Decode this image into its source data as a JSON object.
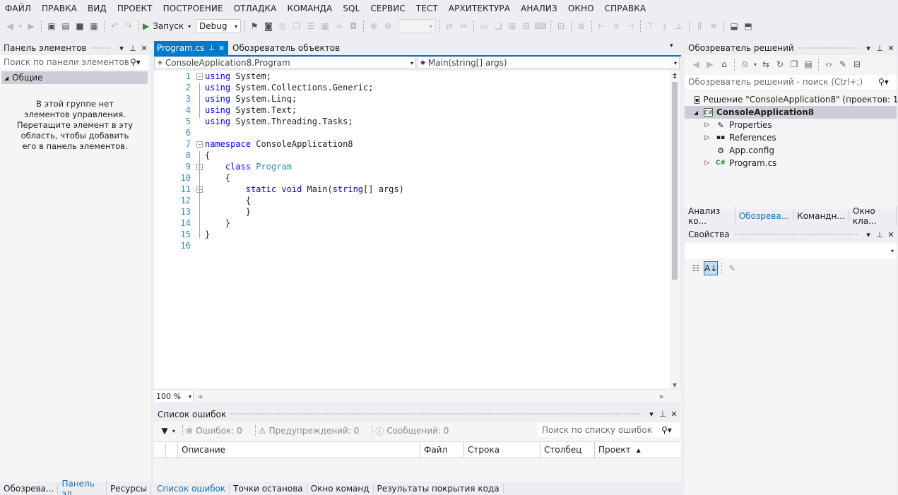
{
  "menu": [
    "ФАЙЛ",
    "ПРАВКА",
    "ВИД",
    "ПРОЕКТ",
    "ПОСТРОЕНИЕ",
    "ОТЛАДКА",
    "КОМАНДА",
    "SQL",
    "СЕРВИС",
    "ТЕСТ",
    "АРХИТЕКТУРА",
    "АНАЛИЗ",
    "ОКНО",
    "СПРАВКА"
  ],
  "toolbar": {
    "run_label": "Запуск",
    "config": "Debug"
  },
  "toolbox": {
    "title": "Панель элементов",
    "search_placeholder": "Поиск по панели элементов",
    "group": "Общие",
    "empty_message": "В этой группе нет элементов управления. Перетащите элемент в эту область, чтобы добавить его в панель элементов."
  },
  "left_tabs": [
    "Обозрева...",
    "Панель эл...",
    "Ресурсы"
  ],
  "editor": {
    "tabs": [
      "Program.cs",
      "Обозреватель объектов"
    ],
    "nav_left": "ConsoleApplication8.Program",
    "nav_right": "Main(string[] args)",
    "zoom": "100 %",
    "lines": [
      {
        "n": "1",
        "t": "using System;"
      },
      {
        "n": "2",
        "t": "using System.Collections.Generic;"
      },
      {
        "n": "3",
        "t": "using System.Linq;"
      },
      {
        "n": "4",
        "t": "using System.Text;"
      },
      {
        "n": "5",
        "t": "using System.Threading.Tasks;"
      },
      {
        "n": "6",
        "t": ""
      },
      {
        "n": "7",
        "t": "namespace ConsoleApplication8"
      },
      {
        "n": "8",
        "t": "{"
      },
      {
        "n": "9",
        "t": "    class Program"
      },
      {
        "n": "10",
        "t": "    {"
      },
      {
        "n": "11",
        "t": "        static void Main(string[] args)"
      },
      {
        "n": "12",
        "t": "        {"
      },
      {
        "n": "13",
        "t": "        }"
      },
      {
        "n": "14",
        "t": "    }"
      },
      {
        "n": "15",
        "t": "}"
      },
      {
        "n": "16",
        "t": ""
      }
    ]
  },
  "errors": {
    "title": "Список ошибок",
    "errors_btn": "Ошибок: 0",
    "warnings_btn": "Предупреждений: 0",
    "messages_btn": "Сообщений: 0",
    "search_placeholder": "Поиск по списку ошибок",
    "columns": [
      "Описание",
      "Файл",
      "Строка",
      "Столбец",
      "Проект"
    ]
  },
  "bottom_tabs": [
    "Список ошибок",
    "Точки останова",
    "Окно команд",
    "Результаты покрытия кода"
  ],
  "solution": {
    "title": "Обозреватель решений",
    "search_placeholder": "Обозреватель решений - поиск (Ctrl+;)",
    "solution_label": "Решение \"ConsoleApplication8\"  (проектов: 1)",
    "project": "ConsoleApplication8",
    "items": [
      "Properties",
      "References",
      "App.config",
      "Program.cs"
    ],
    "tabs": [
      "Анализ ко...",
      "Обозрева...",
      "Командн...",
      "Окно кла..."
    ]
  },
  "properties": {
    "title": "Свойства"
  },
  "colors": {
    "accent": "#007acc",
    "tab_active": "#007acc",
    "keyword": "#0000ff",
    "type": "#2b91af",
    "selection": "#ccced6"
  }
}
